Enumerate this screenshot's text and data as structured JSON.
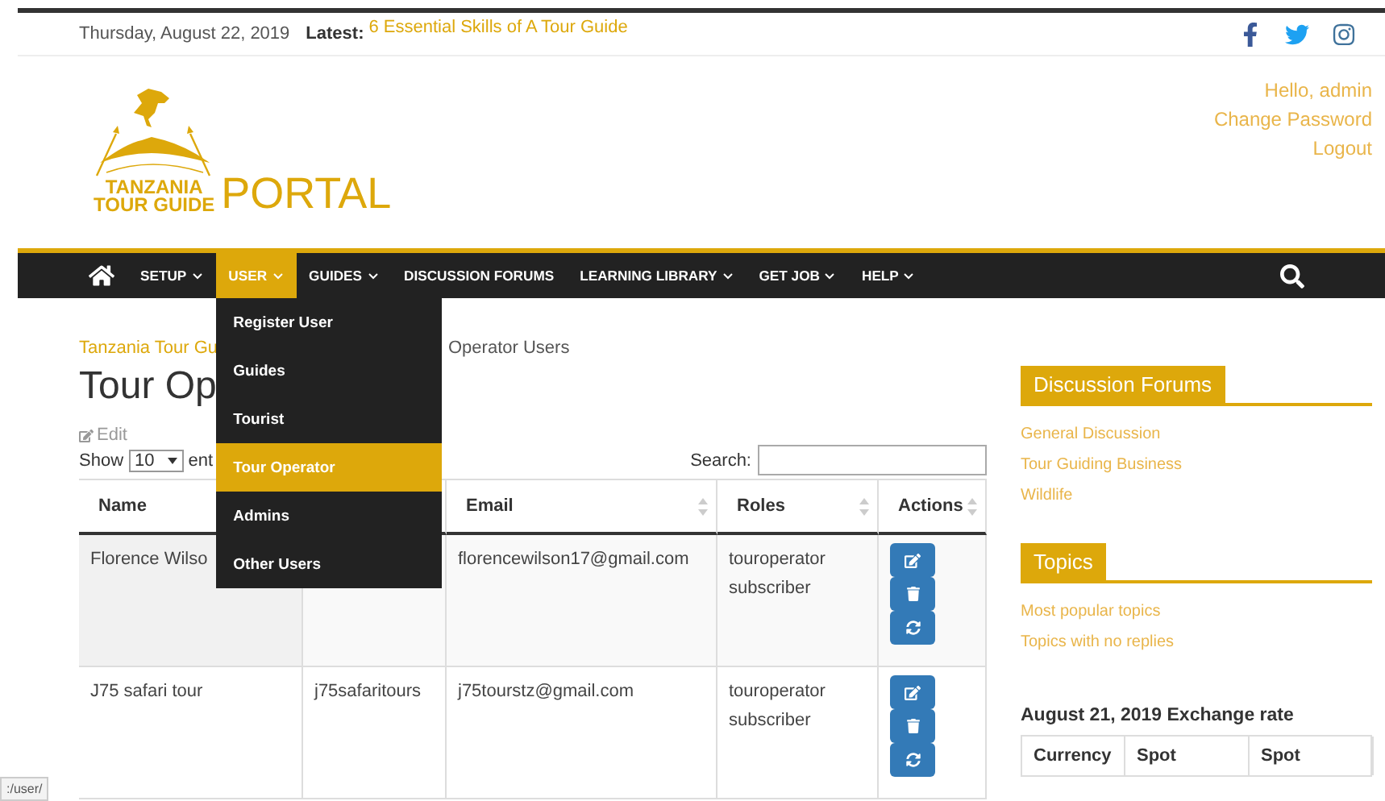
{
  "topbar": {
    "date": "Thursday, August 22, 2019",
    "latest_label": "Latest:",
    "latest_link": "6 Essential Skills of A Tour Guide"
  },
  "logo": {
    "line1": "TANZANIA",
    "line2": "TOUR GUIDE",
    "word": "PORTAL"
  },
  "user_links": [
    "Hello, admin",
    "Change Password",
    "Logout"
  ],
  "nav": [
    {
      "label": "SETUP",
      "caret": true,
      "selected": false
    },
    {
      "label": "USER",
      "caret": true,
      "selected": true
    },
    {
      "label": "GUIDES",
      "caret": true,
      "selected": false
    },
    {
      "label": "DISCUSSION FORUMS",
      "caret": false,
      "selected": false
    },
    {
      "label": "LEARNING LIBRARY",
      "caret": true,
      "selected": false
    },
    {
      "label": "GET JOB",
      "caret": true,
      "selected": false
    },
    {
      "label": "HELP",
      "caret": true,
      "selected": false
    }
  ],
  "dropdown": [
    {
      "label": "Register User",
      "selected": false
    },
    {
      "label": "Guides",
      "selected": false
    },
    {
      "label": "Tourist",
      "selected": false
    },
    {
      "label": "Tour Operator",
      "selected": true
    },
    {
      "label": "Admins",
      "selected": false
    },
    {
      "label": "Other Users",
      "selected": false
    }
  ],
  "breadcrumb": {
    "link": "Tanzania Tour Gu",
    "current": "Operator Users"
  },
  "title": "Tour Op",
  "edit_link": "Edit",
  "length": {
    "before": "Show",
    "value": "10",
    "after": "ent"
  },
  "search_label": "Search:",
  "table": {
    "columns": [
      {
        "label": "Name",
        "sort_icon": false
      },
      {
        "sort_icon": false
      },
      {
        "label": "Email",
        "sort_icon": true
      },
      {
        "label": "Roles",
        "sort_icon": true
      },
      {
        "label": "Actions",
        "sort_icon": true
      }
    ],
    "rows": [
      {
        "selected": false,
        "cells": [
          {
            "kind": "text",
            "text": "Florence Wilso"
          },
          {
            "kind": "empty"
          },
          {
            "kind": "text",
            "text": "florencewilson17@gmail.com"
          },
          {
            "kind": "lines",
            "lines": [
              "touroperator",
              "subscriber"
            ]
          },
          {
            "kind": "actions"
          }
        ]
      },
      {
        "selected": false,
        "cells": [
          {
            "kind": "text",
            "text": "J75 safari tour"
          },
          {
            "kind": "text",
            "text": "j75safaritours"
          },
          {
            "kind": "text",
            "text": "j75tourstz@gmail.com"
          },
          {
            "kind": "lines",
            "lines": [
              "touroperator",
              "subscriber"
            ]
          },
          {
            "kind": "actions"
          }
        ]
      }
    ]
  },
  "sidebar": {
    "forums": {
      "title": "Discussion Forums",
      "links": [
        "General Discussion",
        "Tour Guiding Business",
        "Wildlife"
      ]
    },
    "topics": {
      "title": "Topics",
      "links": [
        "Most popular topics",
        "Topics with no replies"
      ]
    },
    "exchange": {
      "title": "August 21, 2019 Exchange rate",
      "columns": [
        "Currency",
        "Spot",
        "Spot"
      ]
    }
  },
  "status_url": ":/user/"
}
